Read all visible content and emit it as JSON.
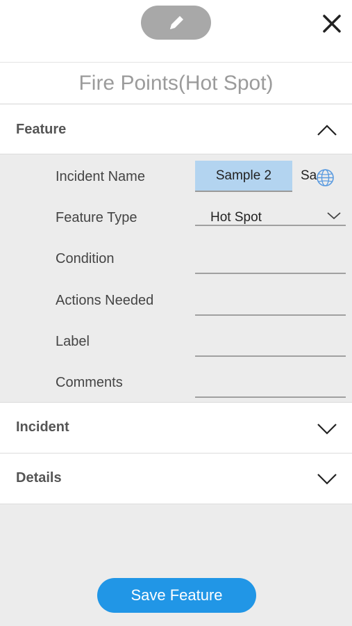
{
  "header": {
    "edit_icon": "pencil-icon",
    "close_icon": "close-icon"
  },
  "title": "Fire Points(Hot Spot)",
  "sections": {
    "feature": {
      "label": "Feature",
      "expanded": true
    },
    "incident": {
      "label": "Incident",
      "expanded": false
    },
    "details": {
      "label": "Details",
      "expanded": false
    }
  },
  "fields": {
    "incident_name": {
      "label": "Incident Name",
      "value": "Sample 2",
      "extra": "Sa"
    },
    "feature_type": {
      "label": "Feature Type",
      "value": "Hot Spot"
    },
    "condition": {
      "label": "Condition",
      "value": ""
    },
    "actions_needed": {
      "label": "Actions Needed",
      "value": ""
    },
    "label": {
      "label": "Label",
      "value": ""
    },
    "comments": {
      "label": "Comments",
      "value": ""
    }
  },
  "save_button": "Save Feature",
  "colors": {
    "accent": "#2196e6",
    "highlight_field": "#b3d4f0",
    "edit_pill": "#a8a8a8"
  }
}
